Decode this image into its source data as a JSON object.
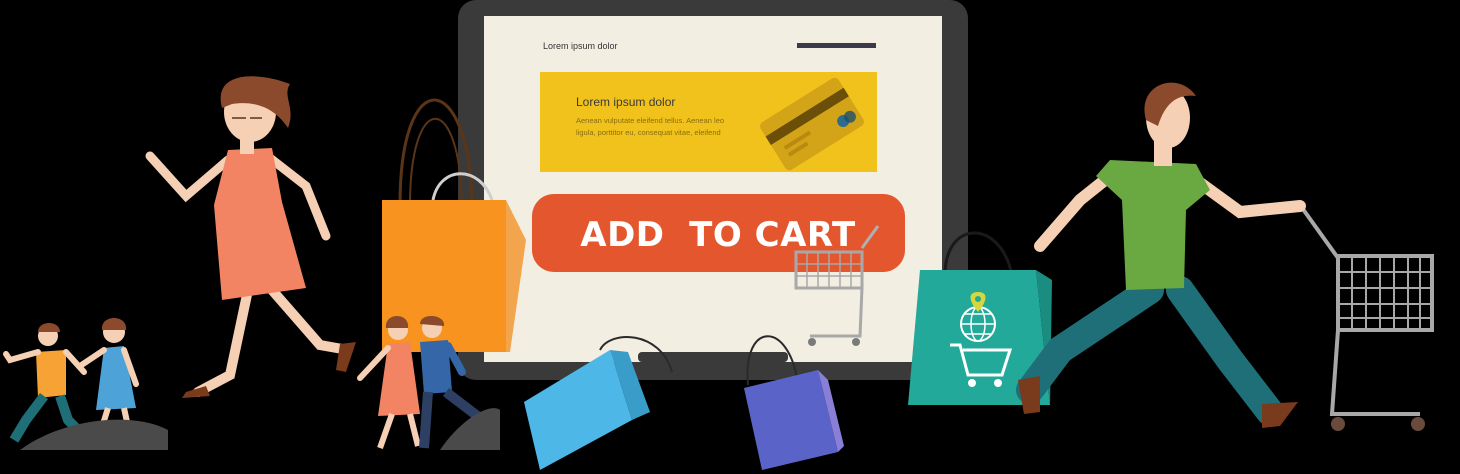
{
  "screen": {
    "header_text": "Lorem ipsum dolor",
    "banner": {
      "title": "Lorem ipsum dolor",
      "body_line_1": "Aenean vulputate eleifend tellus. Aenean leo",
      "body_line_2": "ligula, porttitor eu, consequat vitae, eleifend"
    },
    "cta_label": "ADD  TO CART"
  },
  "colors": {
    "background": "#000000",
    "laptop_frame": "#3a3a3a",
    "screen_bg": "#f3eee2",
    "banner_yellow": "#f1c21b",
    "card_gold": "#d4a418",
    "cta_orange": "#e4572e",
    "cta_text": "#ffffff",
    "bag_orange": "#f7931e",
    "bag_teal": "#22a99a",
    "bag_blue": "#4db8e8",
    "bag_purple": "#5a64c8",
    "woman_dress": "#f28363",
    "man_shirt": "#6aa842",
    "man_pants": "#1f6f78",
    "hair_brown": "#8b4a2b",
    "cart_grey": "#9aa0a6"
  },
  "icons": [
    "credit-card-icon",
    "shopping-cart-icon",
    "globe-icon",
    "location-pin-icon"
  ]
}
